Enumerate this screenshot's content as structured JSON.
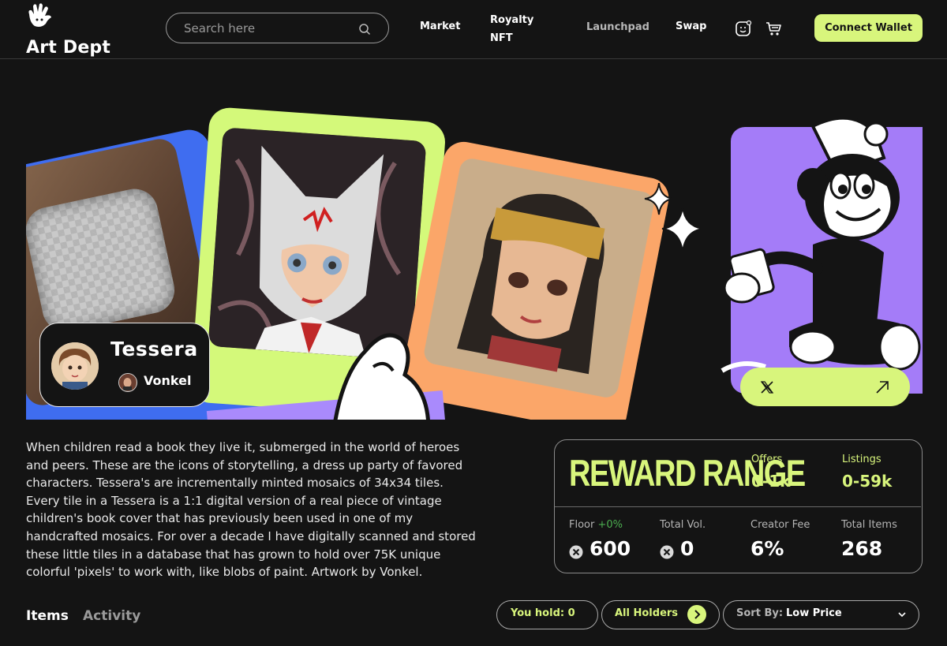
{
  "header": {
    "brand": "Art Dept",
    "search": {
      "placeholder": "Search here",
      "value": ""
    },
    "nav": [
      "Market",
      "Royalty NFT",
      "Launchpad",
      "Swap"
    ],
    "connect_label": "Connect Wallet"
  },
  "colors": {
    "background": "#141414",
    "accent_lime": "#d8f57c",
    "purple": "#a47cf8",
    "blue": "#3f6df0",
    "orange": "#fba669",
    "positive": "#4caf50"
  },
  "collection": {
    "name": "Tessera",
    "creator": "Vonkel",
    "description": "When children read a book they live it, submerged in the world of heroes and peers. These are the icons of storytelling, a dress up party of favored characters. Tessera's are incrementally minted mosaics of 34x34 tiles. Every tile in a Tessera is a 1:1 digital version of a real piece of vintage children's book cover that has previously been used in one of my handcrafted mosaics. For over a decade I have digitally scanned and stored these little tiles in a database that has grown to hold over 75K unique colorful 'pixels' to work with, like blobs of paint. Artwork by Vonkel."
  },
  "stats": {
    "reward_title": "REWARD RANGE",
    "offers": {
      "label": "Offers",
      "value": "0-1k"
    },
    "listings": {
      "label": "Listings",
      "value": "0-59k"
    },
    "floor": {
      "label": "Floor",
      "change": "+0%",
      "value": "600"
    },
    "total_vol": {
      "label": "Total Vol.",
      "value": "0"
    },
    "creator_fee": {
      "label": "Creator Fee",
      "value": "6%"
    },
    "total_items": {
      "label": "Total Items",
      "value": "268"
    }
  },
  "tabs": [
    "Items",
    "Activity"
  ],
  "filters": {
    "you_hold": "You hold: 0",
    "holders": "All Holders",
    "sort_label": "Sort By:",
    "sort_value": "Low Price"
  },
  "icons": [
    "logo-hand-icon",
    "search-icon",
    "profile-icon",
    "cart-icon",
    "x-logo-icon",
    "arrow-up-right-icon",
    "coin-icon",
    "chevron-right-icon",
    "chevron-down-icon"
  ]
}
